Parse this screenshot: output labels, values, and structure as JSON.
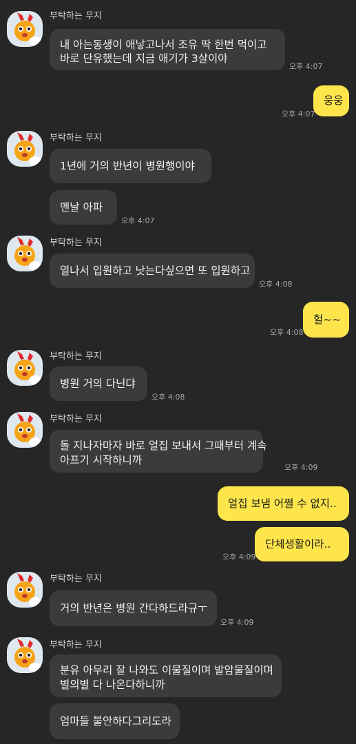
{
  "chat": {
    "sender_name": "부탁하는 무지",
    "avatar_icon": "muzi-rabbit-icon",
    "colors": {
      "background": "#262626",
      "incoming_bubble": "#3b3b3b",
      "outgoing_bubble": "#fde54b"
    },
    "messages": [
      {
        "lines": [
          "내 아는동생이 애낳고나서  조유 딱 한번 먹이고",
          "바로 단유했는데 지금 애기가 3살이야"
        ],
        "time": "오후 4:07"
      },
      {
        "lines": [
          "웅웅"
        ],
        "time": "오후 4:07"
      },
      {
        "lines": [
          "1년에 거의 반년이 병원행이야"
        ]
      },
      {
        "lines": [
          "맨날 아파"
        ],
        "time": "오후 4:07"
      },
      {
        "lines": [
          "열나서 입원하고 낫는다싶으면 또 입원하고"
        ],
        "time": "오후 4:08"
      },
      {
        "lines": [
          "헐~~"
        ],
        "time": "오후 4:08"
      },
      {
        "lines": [
          "병원 거의 다닌댜"
        ],
        "time": "오후 4:08"
      },
      {
        "lines": [
          "돌 지나자마자 바로 얼집 보내서 그때부터 계속",
          "아프기 시작하니까"
        ],
        "time": "오후 4:09"
      },
      {
        "lines": [
          "얼집 보냄 어쩔 수 없지.."
        ]
      },
      {
        "lines": [
          "단체생활이라.."
        ],
        "time": "오후 4:09"
      },
      {
        "lines": [
          "거의 반년은 병원 간다하드라규ㅜ"
        ],
        "time": "오후 4:09"
      },
      {
        "lines": [
          "분유 아무리 잘 나와도 이물질이며 발암물질이며",
          "별의별 다 나온다하니까"
        ]
      },
      {
        "lines": [
          "엄마들 불안하다그리도라"
        ]
      }
    ]
  }
}
